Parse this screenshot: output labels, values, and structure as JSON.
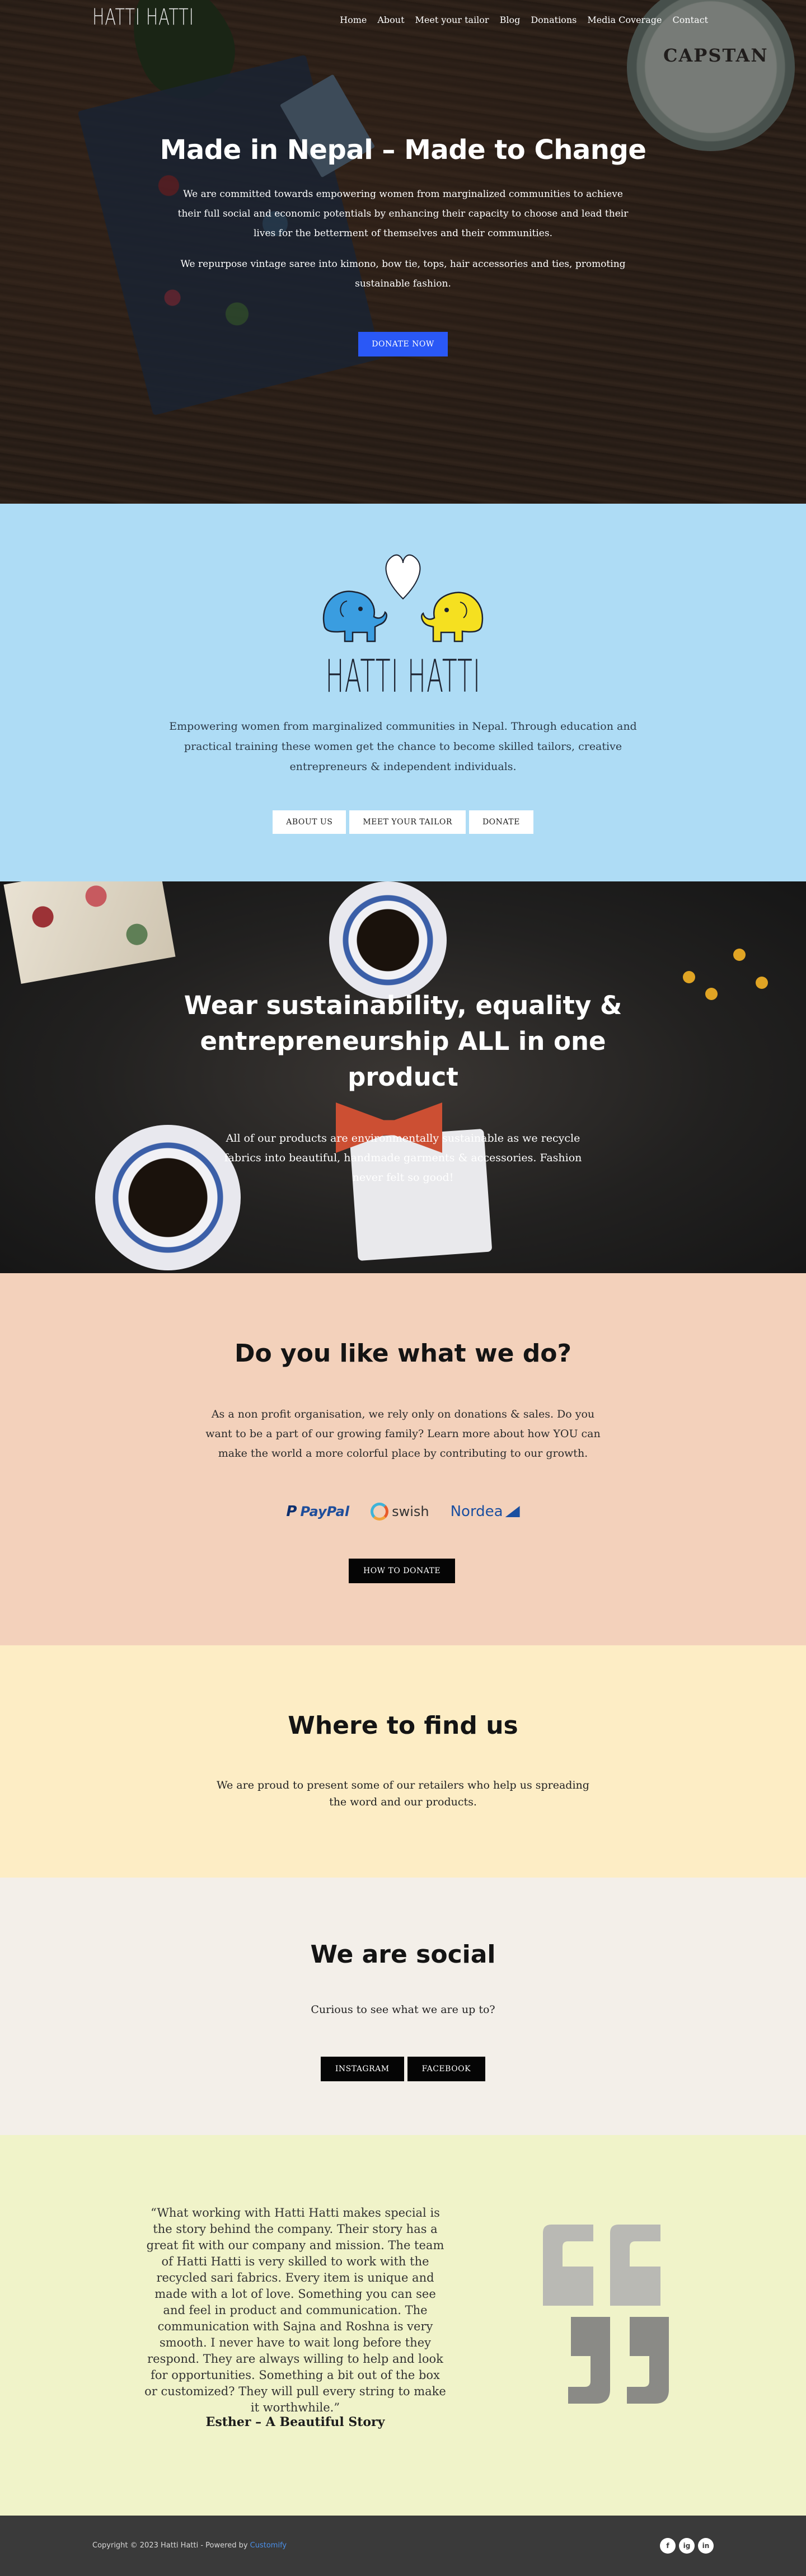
{
  "nav": {
    "logo": "HATTI HATTI",
    "items": [
      {
        "label": "Home"
      },
      {
        "label": "About"
      },
      {
        "label": "Meet your tailor"
      },
      {
        "label": "Blog"
      },
      {
        "label": "Donations"
      },
      {
        "label": "Media Coverage"
      },
      {
        "label": "Contact"
      }
    ]
  },
  "hero": {
    "tin_label": "CAPSTAN",
    "title": "Made in Nepal – Made to Change",
    "paragraph1": "We are committed towards empowering women from marginalized communities to achieve their full social and economic potentials by enhancing their capacity to choose and lead their lives for the betterment of themselves and their communities.",
    "paragraph2": "We repurpose vintage saree into kimono, bow tie, tops, hair accessories and ties, promoting sustainable fashion.",
    "cta_label": "DONATE NOW"
  },
  "about": {
    "logo_text": "HATTI HATTI",
    "paragraph": "Empowering women from marginalized communities in Nepal. Through education and practical training these women get the chance to become skilled tailors, creative entrepreneurs & independent individuals.",
    "buttons": [
      {
        "label": "ABOUT US"
      },
      {
        "label": "MEET YOUR TAILOR"
      },
      {
        "label": "DONATE"
      }
    ]
  },
  "wear": {
    "title": "Wear sustainability, equality & entrepreneurship ALL in one product",
    "paragraph": "All of our products are environmentally sustainable as we recycle fabrics into beautiful, handmade garments & accessories. Fashion never felt so good!"
  },
  "donate": {
    "title": "Do you like what we do?",
    "paragraph": "As a non profit organisation, we rely only on donations & sales. Do you want to be a part of our growing family? Learn more about how YOU can make the world a more colorful place by contributing to our growth.",
    "payment_logos": [
      {
        "name": "PayPal"
      },
      {
        "name": "swish"
      },
      {
        "name": "Nordea"
      }
    ],
    "button_label": "HOW TO DONATE"
  },
  "find": {
    "title": "Where to find us",
    "paragraph": "We are proud to present some of our retailers who help us spreading the word and our products."
  },
  "social": {
    "title": "We are social",
    "paragraph": "Curious to see what we are up to?",
    "buttons": [
      {
        "label": "INSTAGRAM"
      },
      {
        "label": "FACEBOOK"
      }
    ]
  },
  "testimonial": {
    "quote": "“What working with Hatti Hatti makes special is the story behind the company. Their story has a great fit with our company and mission. The team of Hatti Hatti is very skilled to work with the recycled sari fabrics. Every item is unique and made with a lot of love. Something you can see and feel in product and communication. The communication with Sajna and Roshna is very smooth. I never have to wait long before they respond. They are always willing to help and look for opportunities. Something a bit out of the box or customized? They will pull every string to make it worthwhile.”",
    "author": "Esther – A Beautiful Story"
  },
  "footer": {
    "copyright": "Copyright © 2023 Hatti Hatti - Powered by ",
    "powered_link": "Customify",
    "icons": [
      "f",
      "ig",
      "in"
    ]
  },
  "colors": {
    "primary_button": "#2a58f6",
    "about_bg": "#aedcf5",
    "donate_bg": "#f3d1bb",
    "find_bg": "#fdedc5",
    "social_bg": "#f3efe9",
    "testimonial_bg": "#f0f3c9",
    "footer_bg": "#3a3a3a"
  }
}
